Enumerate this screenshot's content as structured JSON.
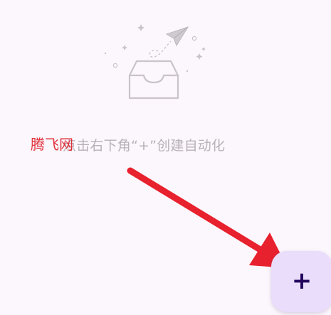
{
  "empty_state": {
    "illustration_icon": "empty-inbox-paper-plane",
    "hint": "点击右下角“+”创建自动化"
  },
  "watermark": {
    "text": "腾飞网"
  },
  "fab": {
    "icon": "plus-icon",
    "label": "+"
  },
  "colors": {
    "background": "#fcf7fd",
    "fab_background": "#e9ddfb",
    "fab_icon": "#21005d",
    "hint_text": "#b7b1b8",
    "annotation_red": "#e8212e"
  }
}
